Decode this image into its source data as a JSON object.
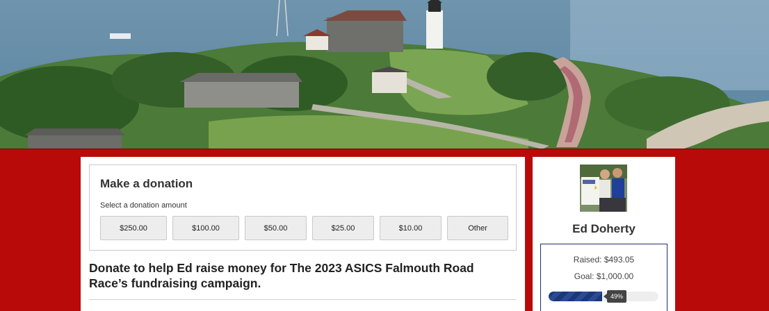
{
  "donation": {
    "title": "Make a donation",
    "amount_label": "Select a donation amount",
    "amounts": [
      "$250.00",
      "$100.00",
      "$50.00",
      "$25.00",
      "$10.00",
      "Other"
    ]
  },
  "campaign_heading": "Donate to help Ed raise money for The 2023 ASICS Falmouth Road Race’s fundraising campaign.",
  "fundraiser": {
    "name": "Ed Doherty",
    "raised": "Raised: $493.05",
    "goal": "Goal: $1,000.00",
    "progress_fraction": 0.49,
    "progress_label": "49%"
  },
  "colors": {
    "background_red": "#b90a0a",
    "progress_blue": "#1c3776"
  }
}
